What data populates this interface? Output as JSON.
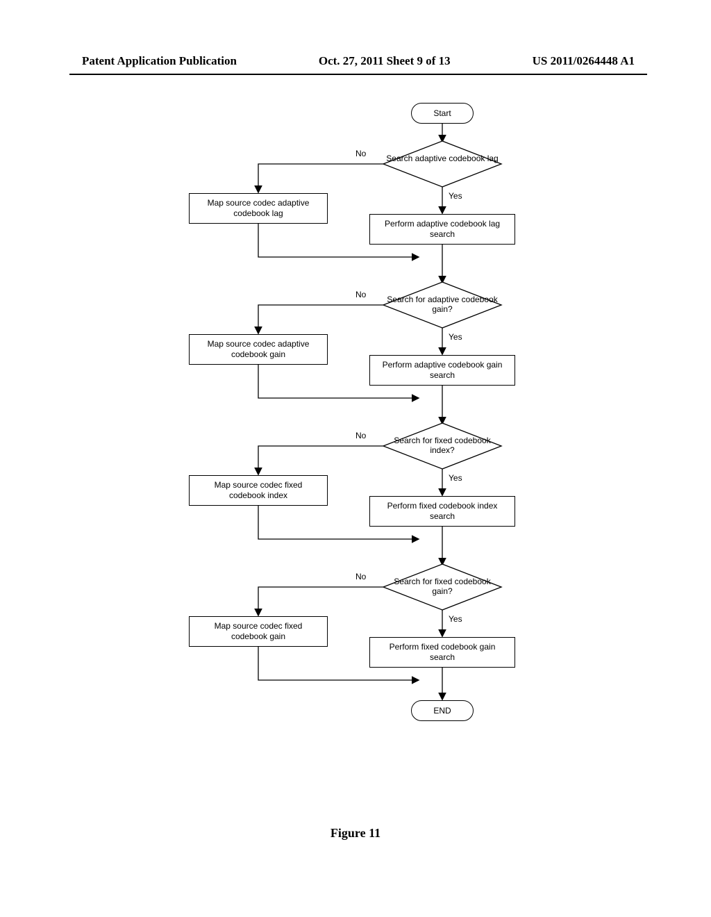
{
  "header": {
    "left": "Patent Application Publication",
    "mid": "Oct. 27, 2011  Sheet 9 of 13",
    "right": "US 2011/0264448 A1"
  },
  "figure_caption": "Figure 11",
  "labels": {
    "no": "No",
    "yes": "Yes"
  },
  "chart_data": {
    "type": "flowchart",
    "nodes": [
      {
        "id": "start",
        "type": "terminal",
        "text": "Start"
      },
      {
        "id": "d1",
        "type": "decision",
        "text": "Search adaptive codebook lag"
      },
      {
        "id": "l1",
        "type": "process",
        "text": "Map source codec adaptive codebook lag"
      },
      {
        "id": "r1",
        "type": "process",
        "text": "Perform adaptive codebook lag search"
      },
      {
        "id": "d2",
        "type": "decision",
        "text": "Search for adaptive codebook gain?"
      },
      {
        "id": "l2",
        "type": "process",
        "text": "Map source codec adaptive codebook gain"
      },
      {
        "id": "r2",
        "type": "process",
        "text": "Perform adaptive codebook gain search"
      },
      {
        "id": "d3",
        "type": "decision",
        "text": "Search for fixed codebook index?"
      },
      {
        "id": "l3",
        "type": "process",
        "text": "Map source codec fixed codebook index"
      },
      {
        "id": "r3",
        "type": "process",
        "text": "Perform fixed codebook index search"
      },
      {
        "id": "d4",
        "type": "decision",
        "text": "Search for fixed codebook gain?"
      },
      {
        "id": "l4",
        "type": "process",
        "text": "Map source codec fixed codebook gain"
      },
      {
        "id": "r4",
        "type": "process",
        "text": "Perform fixed codebook gain search"
      },
      {
        "id": "end",
        "type": "terminal",
        "text": "END"
      }
    ],
    "edges": [
      {
        "from": "start",
        "to": "d1"
      },
      {
        "from": "d1",
        "to": "l1",
        "label": "No"
      },
      {
        "from": "d1",
        "to": "r1",
        "label": "Yes"
      },
      {
        "from": "l1",
        "to": "merge1"
      },
      {
        "from": "r1",
        "to": "merge1"
      },
      {
        "from": "merge1",
        "to": "d2"
      },
      {
        "from": "d2",
        "to": "l2",
        "label": "No"
      },
      {
        "from": "d2",
        "to": "r2",
        "label": "Yes"
      },
      {
        "from": "l2",
        "to": "merge2"
      },
      {
        "from": "r2",
        "to": "merge2"
      },
      {
        "from": "merge2",
        "to": "d3"
      },
      {
        "from": "d3",
        "to": "l3",
        "label": "No"
      },
      {
        "from": "d3",
        "to": "r3",
        "label": "Yes"
      },
      {
        "from": "l3",
        "to": "merge3"
      },
      {
        "from": "r3",
        "to": "merge3"
      },
      {
        "from": "merge3",
        "to": "d4"
      },
      {
        "from": "d4",
        "to": "l4",
        "label": "No"
      },
      {
        "from": "d4",
        "to": "r4",
        "label": "Yes"
      },
      {
        "from": "l4",
        "to": "merge4"
      },
      {
        "from": "r4",
        "to": "merge4"
      },
      {
        "from": "merge4",
        "to": "end"
      }
    ]
  }
}
